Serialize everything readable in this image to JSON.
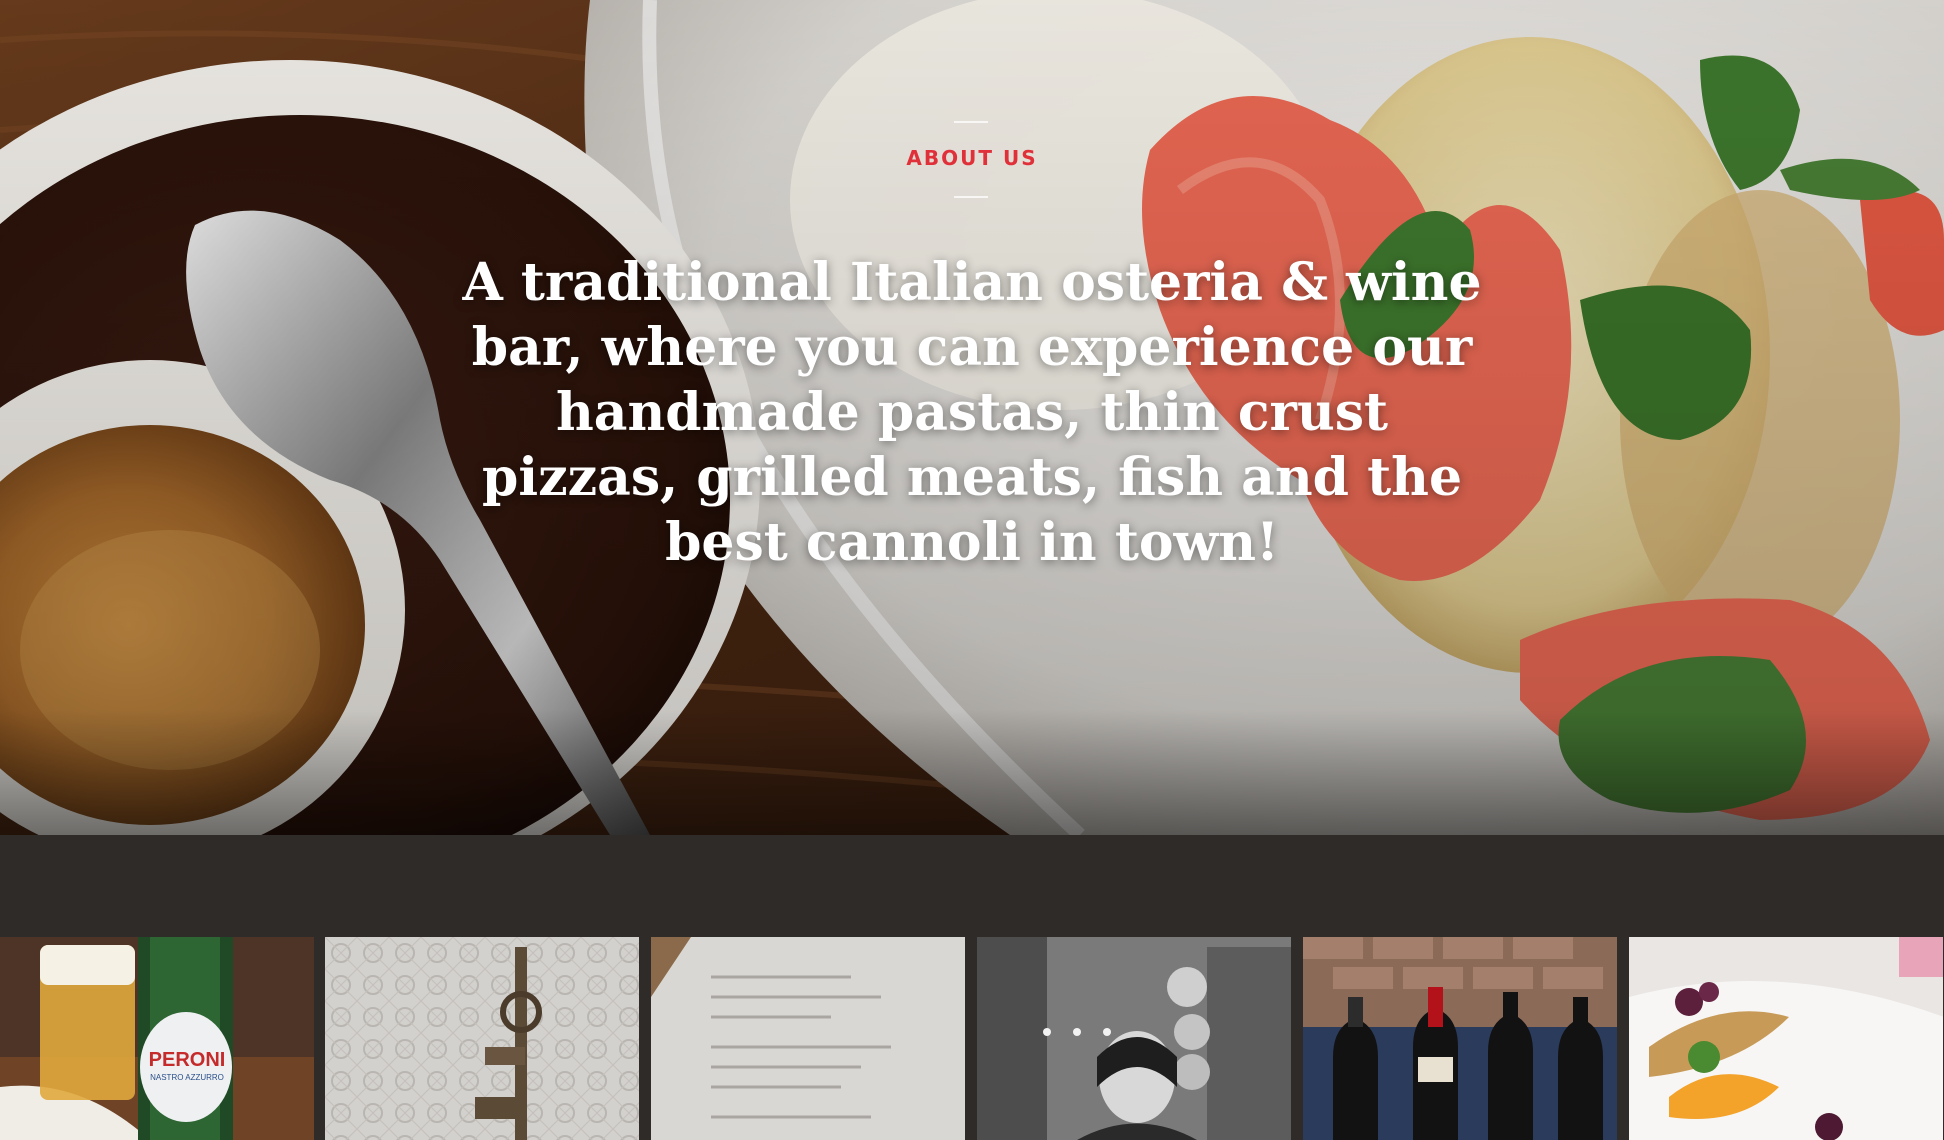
{
  "about": {
    "eyebrow": "ABOUT US",
    "headline": "A traditional Italian osteria & wine bar, where you can experience our handmade pastas, thin crust pizzas, grilled meats, fish and the best cannoli in town!"
  },
  "gallery": {
    "thumb1": {
      "bottle_brand": "PERONI",
      "bottle_sub": "NASTRO AZZURRO",
      "image": "beer-and-peroni-bottle-photo"
    },
    "thumb2": {
      "image": "vintage-tap-on-tiled-wall-photo"
    },
    "thumb3": {
      "image": "printed-menu-photo"
    },
    "thumb4": {
      "image": "chef-portrait-black-and-white-photo"
    },
    "thumb5": {
      "image": "red-wine-bottles-photo"
    },
    "thumb6": {
      "image": "plated-fish-dish-photo"
    }
  },
  "colors": {
    "accent_red": "#e0313a",
    "band": "#2f2b28",
    "headline": "#ffffff"
  }
}
